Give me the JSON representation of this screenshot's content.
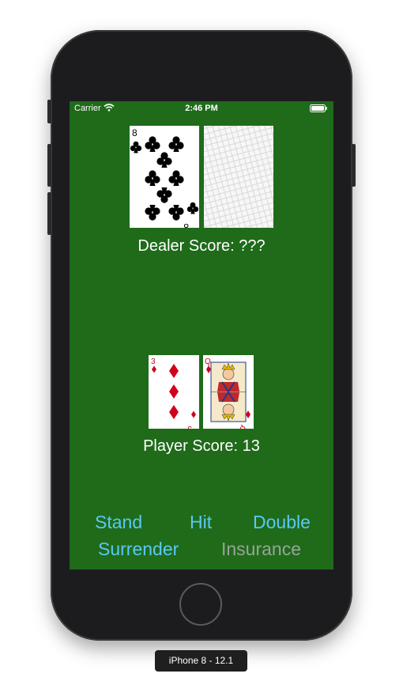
{
  "status_bar": {
    "carrier": "Carrier",
    "time": "2:46 PM"
  },
  "dealer": {
    "cards": [
      {
        "rank": "8",
        "suit": "clubs",
        "face_up": true
      },
      {
        "face_up": false
      }
    ],
    "score_label": "Dealer Score: ???"
  },
  "player": {
    "cards": [
      {
        "rank": "3",
        "suit": "diamonds",
        "face_up": true
      },
      {
        "rank": "Q",
        "suit": "diamonds",
        "face_up": true
      }
    ],
    "score_label": "Player Score: 13"
  },
  "actions": {
    "stand": "Stand",
    "hit": "Hit",
    "double": "Double",
    "surrender": "Surrender",
    "insurance": "Insurance"
  },
  "device_label": "iPhone 8 - 12.1",
  "colors": {
    "felt": "#1f6b1a",
    "action": "#5ac8f5",
    "action_disabled": "#9aa39a",
    "club": "#000000",
    "diamond": "#d0021b"
  }
}
